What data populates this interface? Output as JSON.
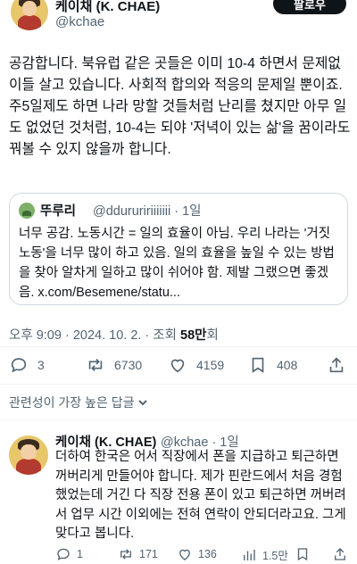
{
  "author": {
    "name": "케이채 (K. CHAE)",
    "handle": "@kchae",
    "follow_label": "팔로우"
  },
  "post": {
    "text": "공감합니다. 북유럽 같은 곳들은 이미 10-4 하면서 문제없이들 살고 있습니다. 사회적 합의와 적응의 문제일 뿐이죠. 주5일제도 하면 나라 망할 것들처럼 난리를 쳤지만 아무 일도 없었던 것처럼, 10-4는 되야 '저녁이 있는 삶'을 꿈이라도 꿔볼 수 있지 않을까 합니다.",
    "time_meta": "오후 9:09 · 2024. 10. 2. · 조회 ",
    "views": "58만",
    "views_suffix": "회"
  },
  "quote": {
    "name": "뚜루리",
    "handle_time": "@dduruririiiiiii · 1일",
    "text": "너무 공감. 노동시간 = 일의 효율이 아님. 우리 나라는 '거짓노동'을 너무 많이 하고 있음. 일의 효율을 높일 수 있는 방법을 찾아 알차게 일하고 많이 쉬어야 함. 제발 그랬으면 좋겠음. x.com/Besemene/statu..."
  },
  "actions": {
    "replies": "3",
    "reposts": "6730",
    "likes": "4159",
    "bookmarks": "408"
  },
  "sort_label": "관련성이 가장 높은 답글",
  "reply": {
    "name": "케이채 (K. CHAE)",
    "handle_time": "@kchae · 1일",
    "text": "더하여 한국은 어서 직장에서 폰을 지급하고 퇴근하면 꺼버리게 만들어야 합니다. 제가 핀란드에서 처음 경험했었는데 거긴 다 직장 전용 폰이 있고 퇴근하면 꺼버려서 업무 시간 이외에는 전혀 연락이 안되더라고요. 그게 맞다고 봅니다.",
    "replies": "1",
    "reposts": "171",
    "likes": "136",
    "views": "1.5만"
  },
  "colors": {
    "text": "#0f1419",
    "secondary": "#536471",
    "border": "#cfd9de",
    "button_bg": "#0f1419"
  }
}
